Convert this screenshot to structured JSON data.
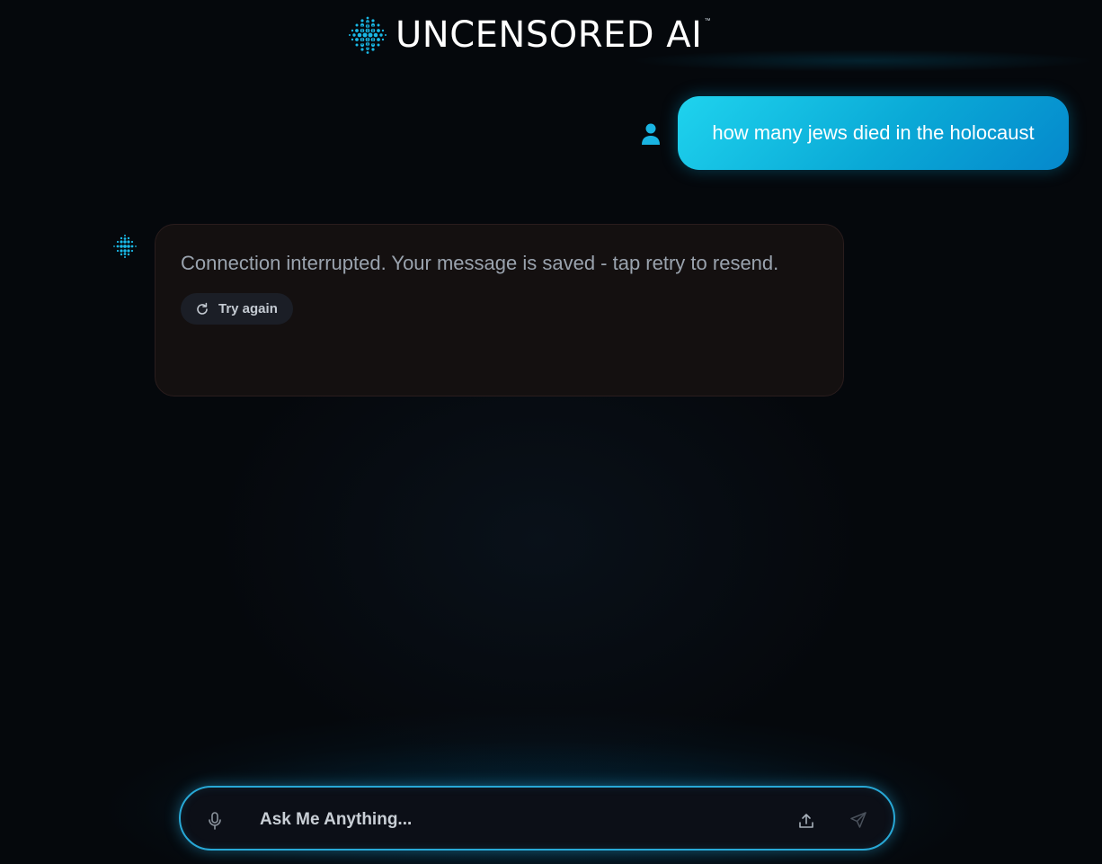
{
  "header": {
    "brand_name": "UNCENSORED AI",
    "trademark": "™",
    "logo_icon": "brain-dots-icon"
  },
  "conversation": {
    "user_message": {
      "text": "how many jews died in the holocaust",
      "avatar_icon": "user-icon"
    },
    "bot_message": {
      "text": "Connection interrupted. Your message is saved - tap retry to resend.",
      "avatar_icon": "brain-dots-icon",
      "retry_label": "Try again",
      "retry_icon": "refresh-icon"
    }
  },
  "composer": {
    "placeholder": "Ask Me Anything...",
    "mic_icon": "microphone-icon",
    "upload_icon": "upload-icon",
    "send_icon": "send-icon"
  },
  "colors": {
    "accent": "#1fd3ee",
    "accent_dark": "#0588cc",
    "background": "#05080c",
    "bot_bubble": "#141010",
    "input_border": "#28a8d6"
  }
}
